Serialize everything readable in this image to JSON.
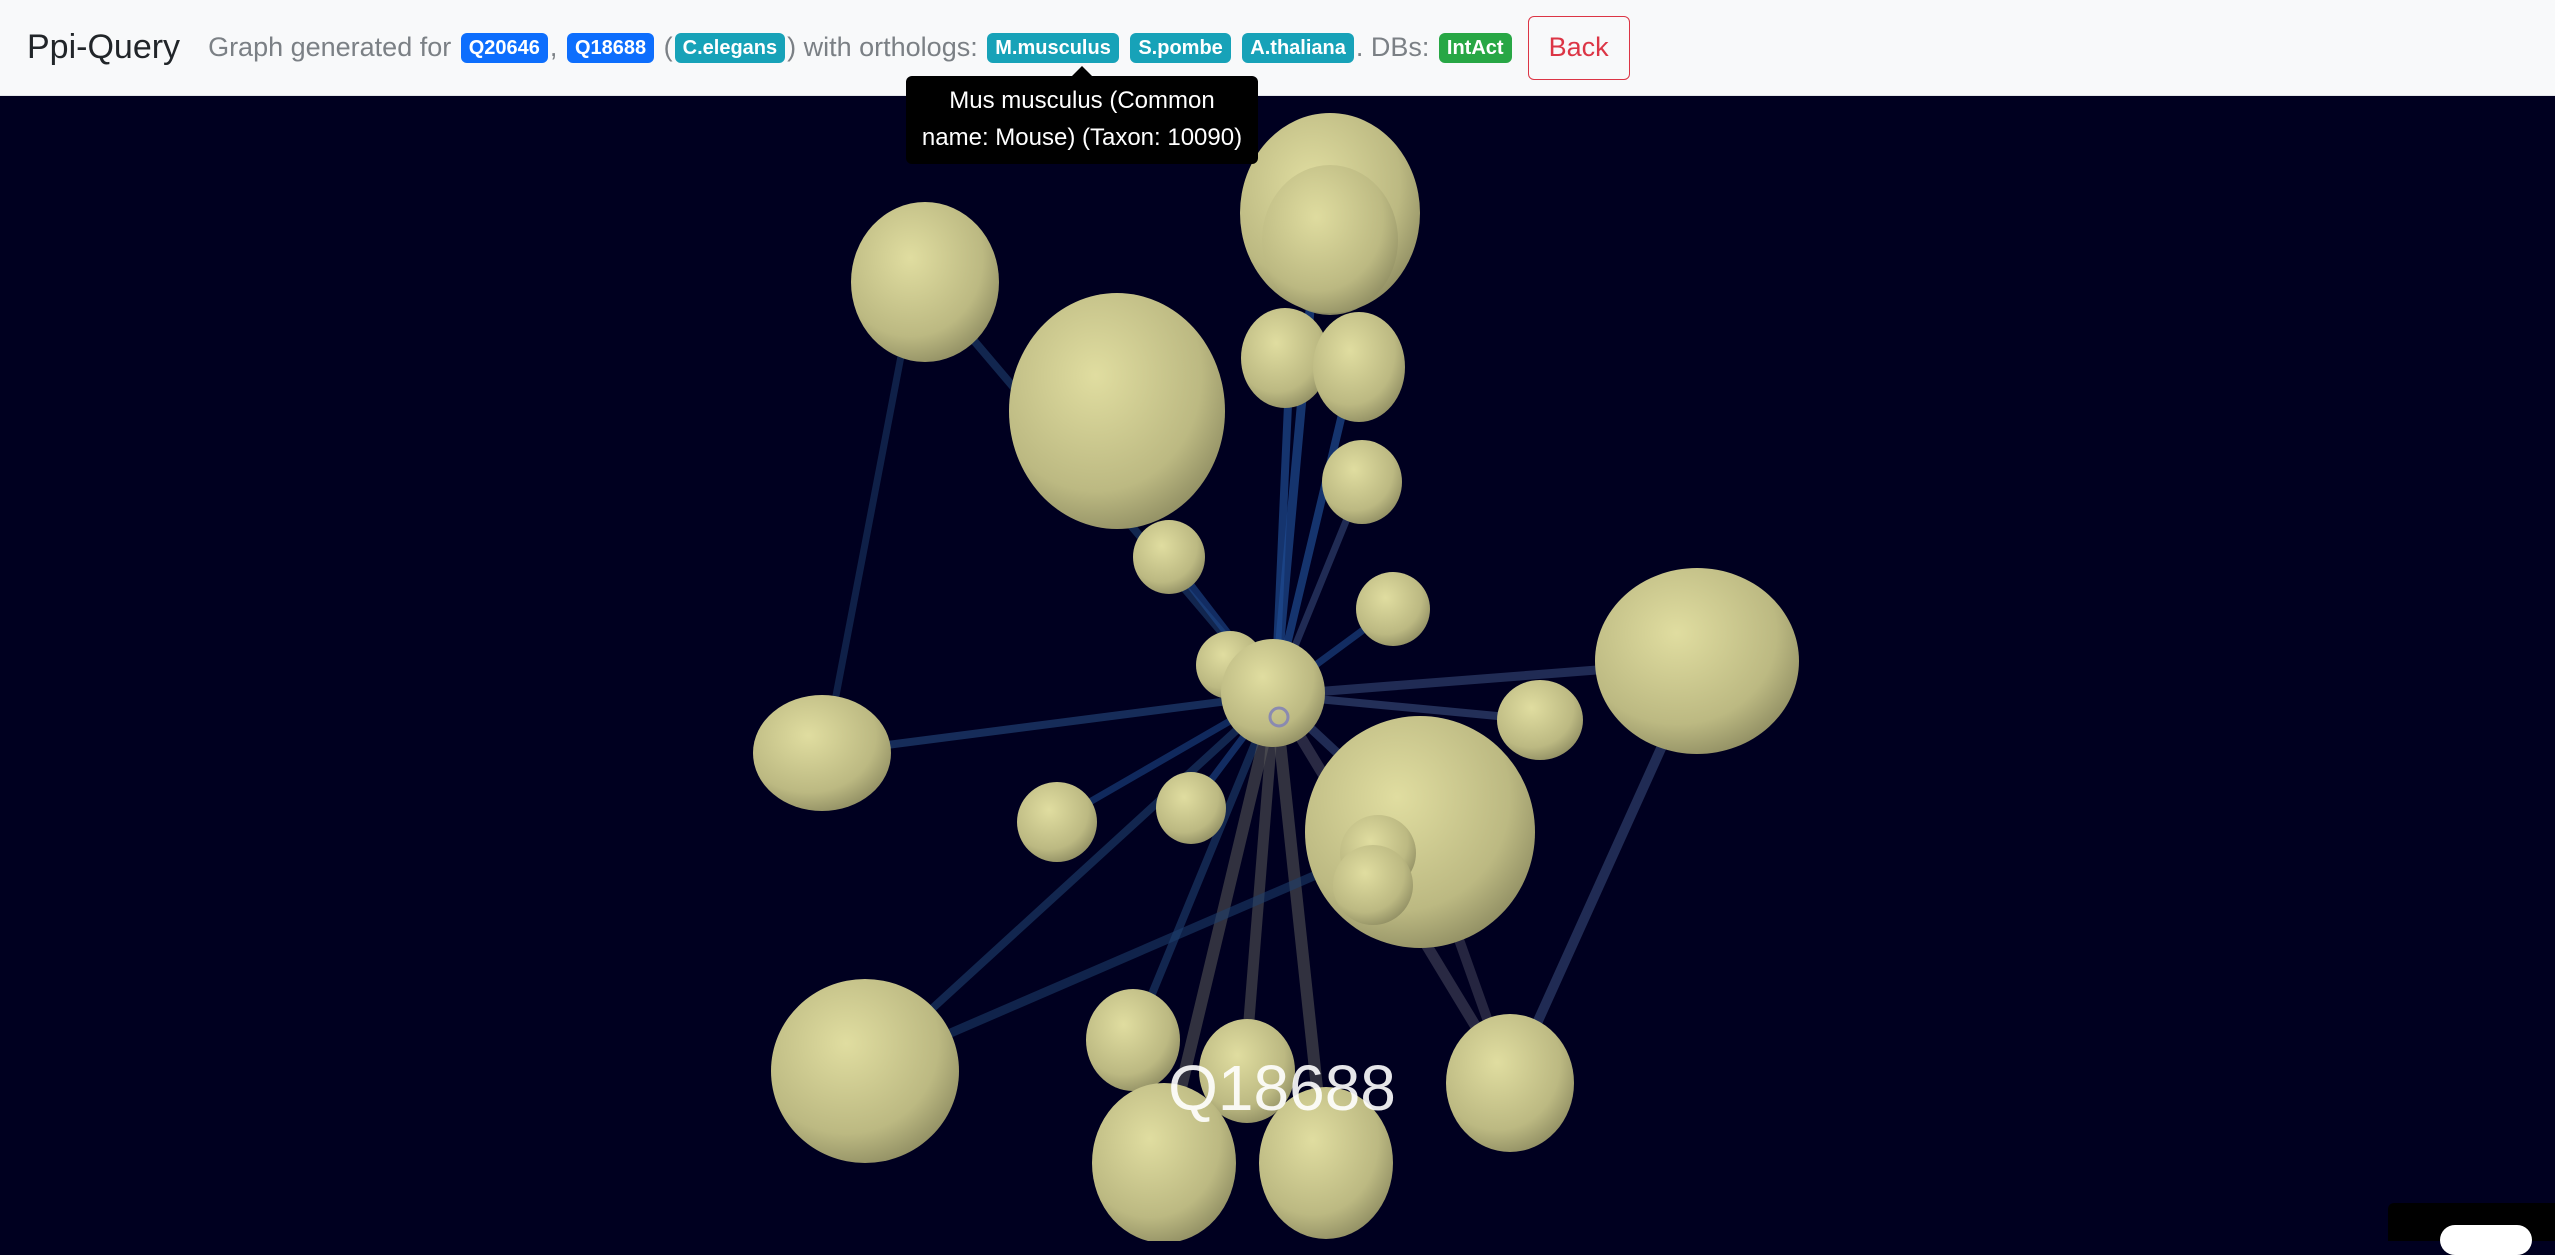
{
  "app": {
    "brand": "Ppi-Query"
  },
  "header": {
    "text_prefix": "Graph generated for",
    "comma": ",",
    "open_paren": "(",
    "close_paren_with_orthologs": ") with orthologs:",
    "dbs_label": ". DBs:",
    "proteins": [
      "Q20646",
      "Q18688"
    ],
    "organism": "C.elegans",
    "orthologs": [
      "M.musculus",
      "S.pombe",
      "A.thaliana"
    ],
    "dbs": [
      "IntAct"
    ],
    "back_label": "Back"
  },
  "tooltip": {
    "text": "Mus musculus (Common name: Mouse) (Taxon: 10090)"
  },
  "graph": {
    "focus_label": "Q18688",
    "background_color": "#000020",
    "node_color": "#c9c68a",
    "edge_color": "#2a4f8a"
  }
}
